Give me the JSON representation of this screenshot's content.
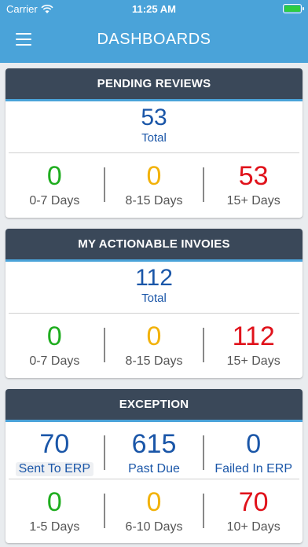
{
  "status_bar": {
    "carrier": "Carrier",
    "time": "11:25 AM"
  },
  "header": {
    "title": "DASHBOARDS",
    "menu_icon": "hamburger-menu-icon"
  },
  "pending_reviews": {
    "title": "PENDING REVIEWS",
    "total_value": "53",
    "total_label": "Total",
    "buckets": [
      {
        "value": "0",
        "label": "0-7 Days",
        "color": "#1fad1f"
      },
      {
        "value": "0",
        "label": "8-15 Days",
        "color": "#f2b20a"
      },
      {
        "value": "53",
        "label": "15+ Days",
        "color": "#e0121b"
      }
    ]
  },
  "actionable_invoices": {
    "title": "MY ACTIONABLE INVOIES",
    "total_value": "112",
    "total_label": "Total",
    "buckets": [
      {
        "value": "0",
        "label": "0-7 Days",
        "color": "#1fad1f"
      },
      {
        "value": "0",
        "label": "8-15 Days",
        "color": "#f2b20a"
      },
      {
        "value": "112",
        "label": "15+ Days",
        "color": "#e0121b"
      }
    ]
  },
  "exception": {
    "title": "EXCEPTION",
    "summary": [
      {
        "value": "70",
        "label": "Sent To ERP"
      },
      {
        "value": "615",
        "label": "Past Due"
      },
      {
        "value": "0",
        "label": "Failed In ERP"
      }
    ],
    "buckets": [
      {
        "value": "0",
        "label": "1-5 Days",
        "color": "#1fad1f"
      },
      {
        "value": "0",
        "label": "6-10 Days",
        "color": "#f2b20a"
      },
      {
        "value": "70",
        "label": "10+ Days",
        "color": "#e0121b"
      }
    ]
  },
  "colors": {
    "header": "#4aa3d9",
    "card_header": "#3a4859",
    "total_blue": "#1a56a8"
  }
}
